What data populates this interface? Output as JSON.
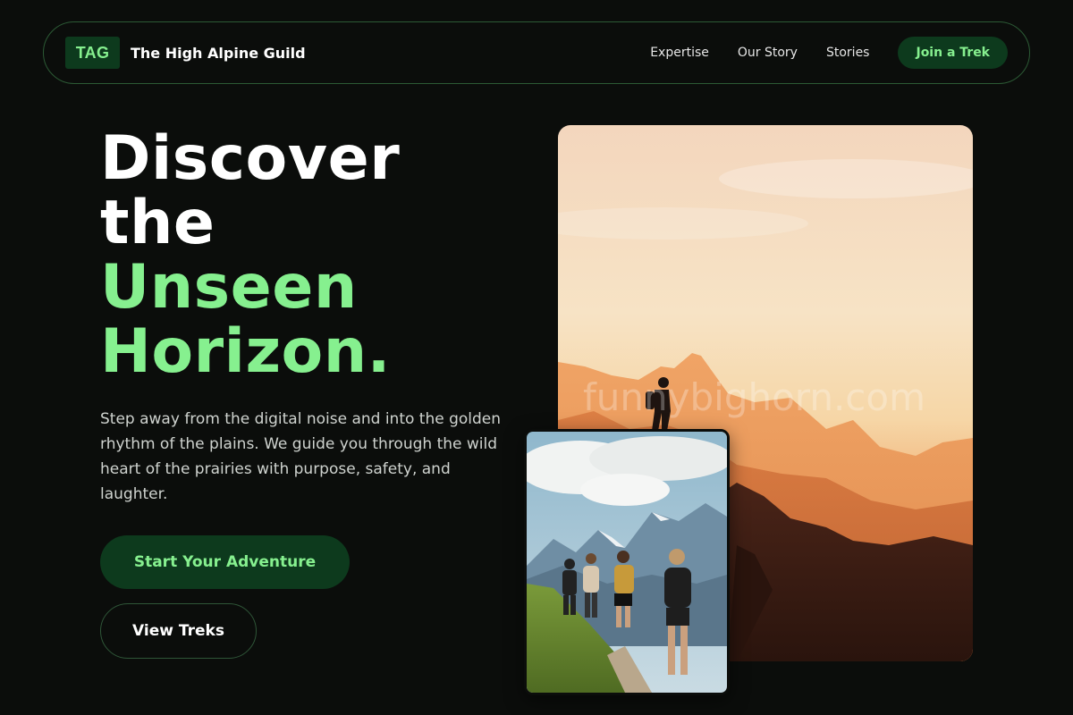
{
  "nav": {
    "logo_text": "TAG",
    "brand_name": "The High Alpine Guild",
    "links": [
      "Expertise",
      "Our Story",
      "Stories"
    ],
    "cta_label": "Join a Trek"
  },
  "hero": {
    "title_line1": "Discover",
    "title_line2": "the",
    "title_accent_line1": "Unseen",
    "title_accent_line2": "Horizon.",
    "description": "Step away from the digital noise and into the golden rhythm of the plains. We guide you through the wild heart of the prairies with purpose, safety, and laughter.",
    "primary_button": "Start Your Adventure",
    "secondary_button": "View Treks"
  },
  "images": {
    "main_watermark": "funnybighorn.com"
  },
  "colors": {
    "background": "#0b0d0b",
    "accent": "#86f08f",
    "accent_dark": "#0d3a1d"
  }
}
